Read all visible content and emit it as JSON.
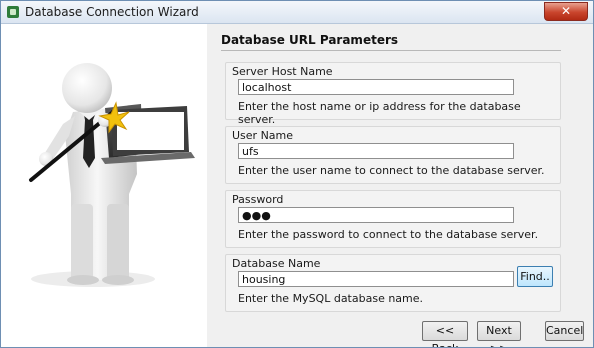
{
  "window": {
    "title": "Database Connection Wizard",
    "close_icon": "close-icon",
    "app_icon": "wizard-app-icon"
  },
  "illustration": {
    "icon": "wizard-figure-with-magic-wand-and-laptop"
  },
  "content": {
    "section_title": "Database URL Parameters",
    "fields": {
      "host": {
        "label": "Server Host Name",
        "value": "localhost",
        "hint": "Enter the host name or ip address for the database server."
      },
      "user": {
        "label": "User Name",
        "value": "ufs",
        "hint": "Enter the user name to connect to the database server."
      },
      "password": {
        "label": "Password",
        "value": "●●●",
        "hint": "Enter the password to connect to the database server."
      },
      "database": {
        "label": "Database Name",
        "value": "housing",
        "hint": "Enter the MySQL database name.",
        "find_label": "Find.."
      }
    }
  },
  "footer": {
    "back_label": "<< Back",
    "next_label": "Next >>",
    "cancel_label": "Cancel"
  }
}
